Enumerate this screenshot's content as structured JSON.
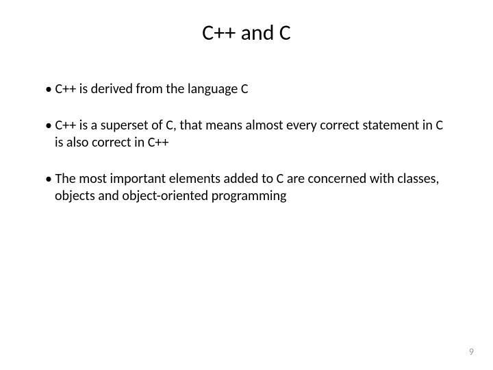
{
  "title": "C++ and C",
  "bullets": [
    "C++ is derived from the language C",
    "C++ is a superset of C, that means almost every correct statement in C is also correct in C++",
    "The most important elements added to C are concerned with classes, objects and object-oriented programming"
  ],
  "bullet_char": "•",
  "page_number": "9"
}
